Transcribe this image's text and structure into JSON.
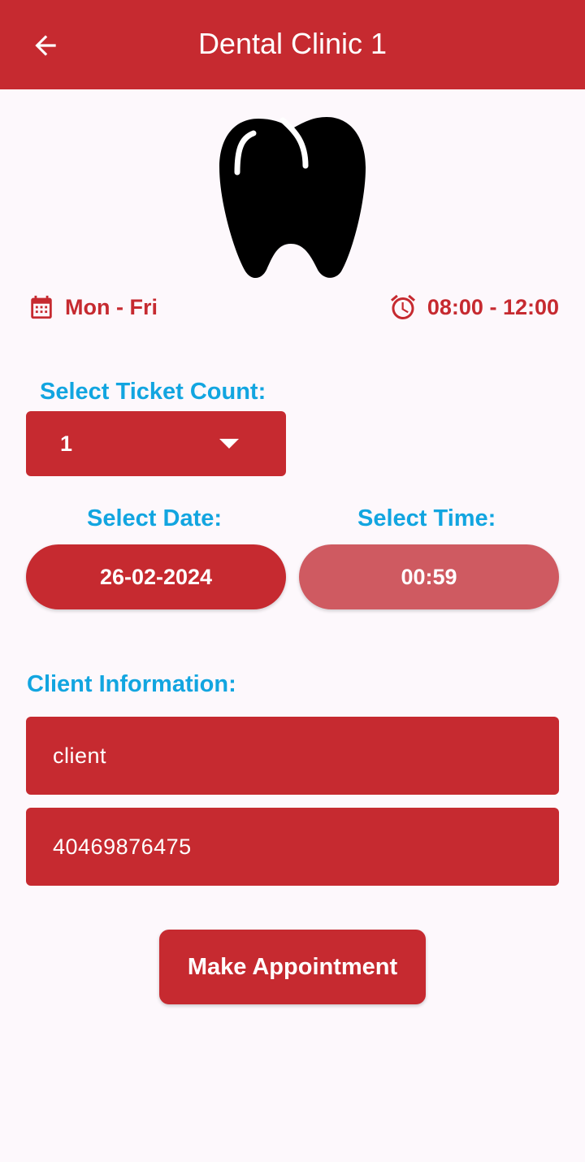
{
  "app_bar": {
    "title": "Dental Clinic 1",
    "back_icon": "arrow-left-icon",
    "background": "#c62a30"
  },
  "clinic": {
    "image_icon": "tooth-icon",
    "days_icon": "calendar-icon",
    "days": "Mon - Fri",
    "hours_icon": "alarm-clock-icon",
    "hours": "08:00 - 12:00"
  },
  "ticket": {
    "label": "Select Ticket Count:",
    "selected_value": "1",
    "dropdown_icon": "caret-down-icon"
  },
  "date": {
    "label": "Select Date:",
    "value": "26-02-2024"
  },
  "time": {
    "label": "Select Time:",
    "value": "00:59"
  },
  "client": {
    "label": "Client Information:",
    "name_value": "client",
    "phone_value": "40469876475"
  },
  "actions": {
    "make_appointment_label": "Make Appointment"
  },
  "colors": {
    "primary": "#c62a30",
    "primary_light": "#cf5a61",
    "label_blue": "#12a5e0",
    "background": "#fdf8fc"
  }
}
